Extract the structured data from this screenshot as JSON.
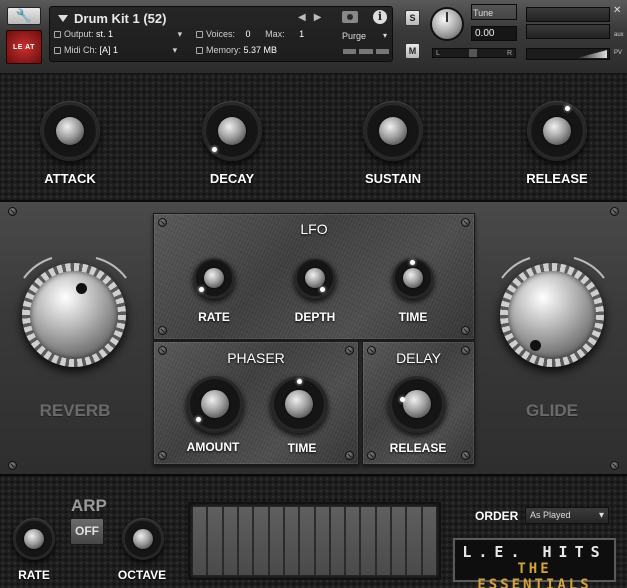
{
  "header": {
    "instrument_name": "Drum Kit 1 (52)",
    "logo_text": "LE AT",
    "output_label": "Output:",
    "output_value": "st. 1",
    "voices_label": "Voices:",
    "voices_value": "0",
    "max_label": "Max:",
    "max_value": "1",
    "midi_label": "Midi Ch:",
    "midi_value": "[A]  1",
    "memory_label": "Memory:",
    "memory_value": "5.37 MB",
    "purge_label": "Purge",
    "solo_label": "S",
    "mute_label": "M",
    "tune_label": "Tune",
    "tune_value": "0.00",
    "pan_left": "L",
    "pan_right": "R",
    "aux_label": "aux",
    "pv_label": "PV",
    "info_label": "i"
  },
  "envelope": {
    "attack": "ATTACK",
    "decay": "DECAY",
    "sustain": "SUSTAIN",
    "release": "RELEASE"
  },
  "effects": {
    "reverb": "REVERB",
    "glide": "GLIDE",
    "lfo": {
      "title": "LFO",
      "rate": "RATE",
      "depth": "DEPTH",
      "time": "TIME"
    },
    "phaser": {
      "title": "PHASER",
      "amount": "AMOUNT",
      "time": "TIME"
    },
    "delay": {
      "title": "DELAY",
      "release": "RELEASE"
    }
  },
  "arp": {
    "title": "ARP",
    "toggle": "OFF",
    "rate": "RATE",
    "octave": "OCTAVE",
    "order_label": "ORDER",
    "order_value": "As Played",
    "step_count": 16
  },
  "brand": {
    "line1": "L.E. HITS",
    "line2": "THE ESSENTIALS"
  },
  "colors": {
    "brand_gold": "#d4a33c",
    "logo_red": "#c83030"
  }
}
